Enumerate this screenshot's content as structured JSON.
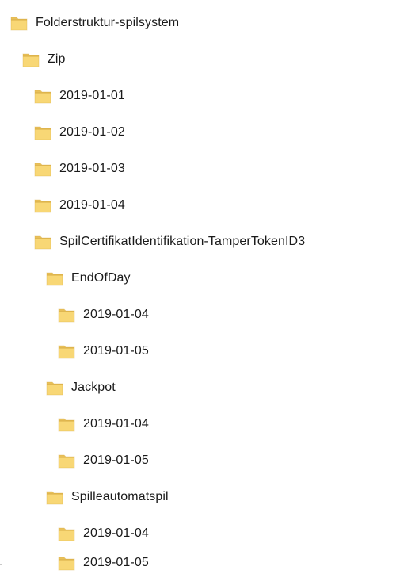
{
  "tree": {
    "items": [
      {
        "label": "Folderstruktur-spilsystem",
        "level": 0
      },
      {
        "label": "Zip",
        "level": 1
      },
      {
        "label": "2019-01-01",
        "level": 2
      },
      {
        "label": "2019-01-02",
        "level": 2
      },
      {
        "label": "2019-01-03",
        "level": 2
      },
      {
        "label": "2019-01-04",
        "level": 2
      },
      {
        "label": "SpilCertifikatIdentifikation-TamperTokenID3",
        "level": 2
      },
      {
        "label": "EndOfDay",
        "level": 3
      },
      {
        "label": "2019-01-04",
        "level": 4
      },
      {
        "label": "2019-01-05",
        "level": 4
      },
      {
        "label": "Jackpot",
        "level": 3
      },
      {
        "label": "2019-01-04",
        "level": 4
      },
      {
        "label": "2019-01-05",
        "level": 4
      },
      {
        "label": "Spilleautomatspil",
        "level": 3
      },
      {
        "label": "2019-01-04",
        "level": 4
      },
      {
        "label": "2019-01-05",
        "level": 4
      }
    ]
  },
  "icons": {
    "folder": "folder-icon"
  },
  "colors": {
    "folder_fill": "#F8D775",
    "folder_tab": "#E8C05A",
    "folder_edge": "#D9AE45",
    "text": "#1a1a1a"
  }
}
